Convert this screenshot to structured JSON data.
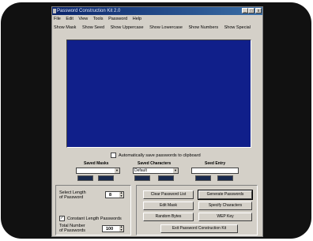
{
  "window": {
    "title": "Password Construction Kit 2.0"
  },
  "menu": [
    "File",
    "Edit",
    "View",
    "Tools",
    "Password",
    "Help"
  ],
  "toolbar": [
    "Show Mask",
    "Show Seed",
    "Show Uppercase",
    "Show Lowercase",
    "Show Numbers",
    "Show Special"
  ],
  "options": {
    "autosave_label": "Automatically save passwords to clipboard"
  },
  "groups": {
    "seed_masks_label": "Saved Masks",
    "seed_characters_label": "Saved Characters",
    "seed_characters_value": "Default",
    "seed_entry_label": "Seed Entry"
  },
  "length": {
    "select_label_1": "Select Length",
    "select_label_2": "of Password",
    "length_value": "8",
    "constant_label": "Constant Length Passwords",
    "total_label_1": "Total Number",
    "total_label_2": "of Passwords",
    "total_value": "100"
  },
  "buttons": {
    "clear": "Clear Password List",
    "generate": "Generate Passwords",
    "edit_mask": "Edit Mask",
    "specify": "Specify Characters",
    "random": "Random Bytes",
    "wep": "WEP Key",
    "exit": "Exit Password Construction Kit"
  },
  "icons": {
    "minimize": "minimize-icon",
    "maximize": "maximize-icon",
    "close": "close-icon",
    "dropdown": "chevron-down-icon",
    "spinner": "spinner-arrows-icon"
  },
  "colors": {
    "display_bg": "#101f8a",
    "title_bar": "#0a246a",
    "window_bg": "#d4d0c8"
  }
}
